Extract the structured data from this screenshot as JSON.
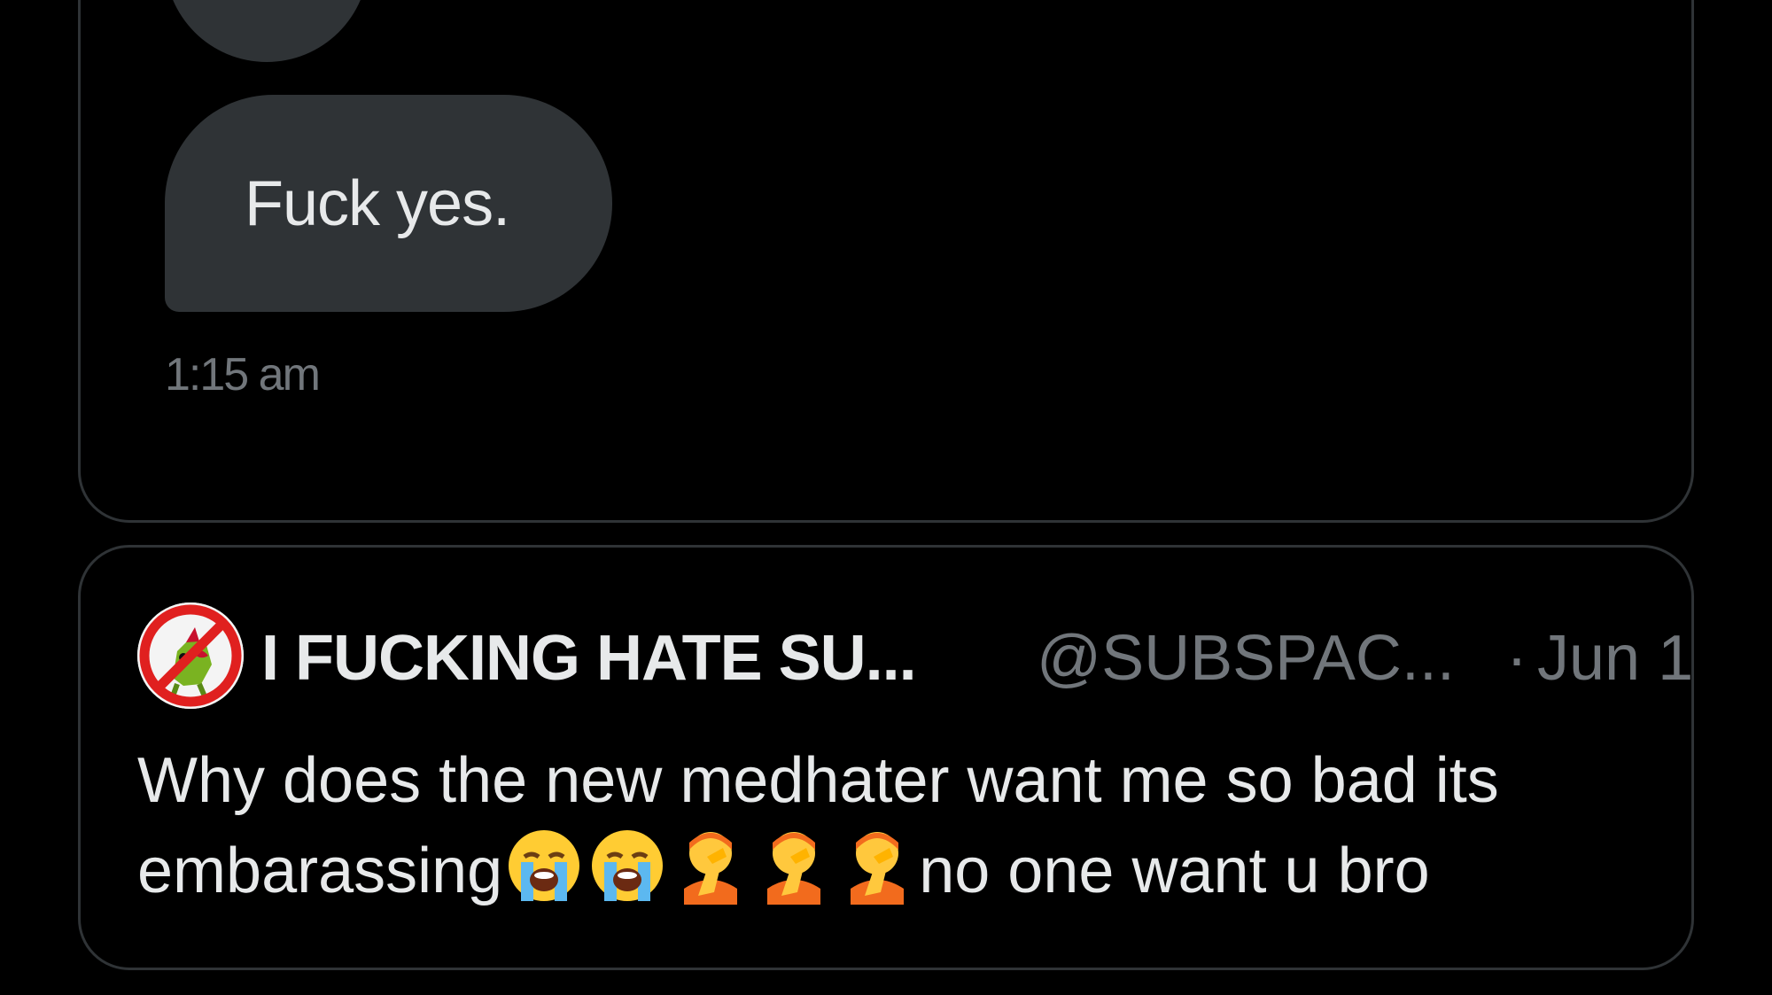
{
  "dm": {
    "typing_indicator": "...",
    "message": "Fuck yes.",
    "timestamp": "1:15 am"
  },
  "quoted_post": {
    "author_name": "I FUCKING HATE SU...",
    "author_handle": "@SUBSPAC...",
    "separator": "·",
    "date": "Jun 1",
    "text_line1": "Why does the new medhater want me so bad its",
    "text_line2_start": "embarassing",
    "text_line2_end": "no one want u bro",
    "emojis": [
      "loudly-crying-face",
      "loudly-crying-face",
      "person-facepalming",
      "person-facepalming",
      "person-facepalming"
    ]
  },
  "colors": {
    "background": "#000000",
    "bubble": "#2f3336",
    "border": "#2f3336",
    "primary_text": "#e7e9ea",
    "secondary_text": "#71767b",
    "avatar_ban": "#e0201f"
  }
}
